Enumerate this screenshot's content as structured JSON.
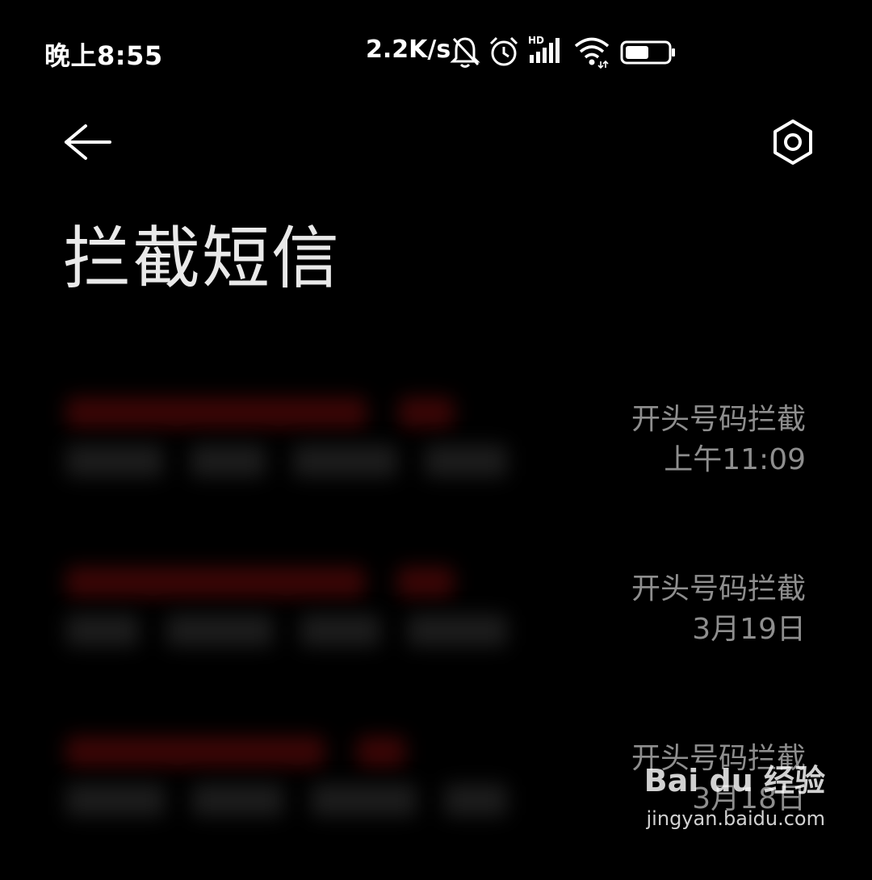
{
  "status_bar": {
    "time": "晚上8:55",
    "network_speed": "2.2K/s",
    "icons": [
      "bell-muted-icon",
      "alarm-icon",
      "hd-signal-icon",
      "wifi-icon",
      "battery-icon"
    ],
    "signal_label": "HD",
    "battery_level": 0.55
  },
  "header": {
    "back_icon": "arrow-left-icon",
    "settings_icon": "hexagon-settings-icon",
    "title": "拦截短信"
  },
  "messages": [
    {
      "reason": "开头号码拦截",
      "time": "上午11:09"
    },
    {
      "reason": "开头号码拦截",
      "time": "3月19日"
    },
    {
      "reason": "开头号码拦截",
      "time": "3月18日"
    }
  ],
  "watermark": {
    "logo": "Bai du 经验",
    "url": "jingyan.baidu.com"
  },
  "colors": {
    "background": "#000000",
    "title": "#e9e9e9",
    "secondary_text": "#8e8e8e",
    "blurred_sender": "#5a0c0c"
  }
}
